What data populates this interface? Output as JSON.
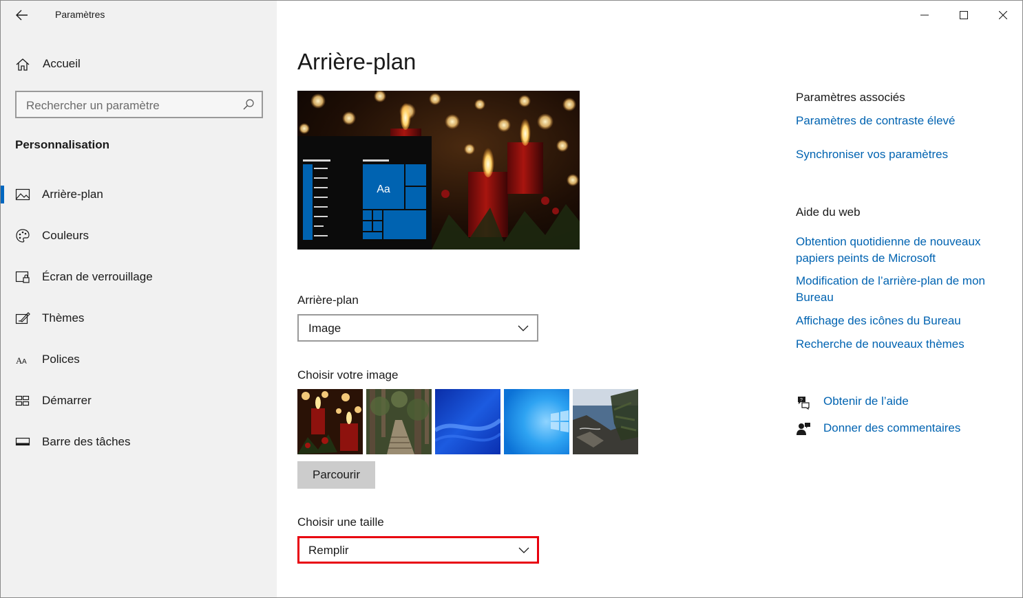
{
  "window": {
    "app_title": "Paramètres",
    "back_icon": "back-arrow-icon",
    "controls": [
      "minimize-icon",
      "maximize-icon",
      "close-icon"
    ]
  },
  "sidebar": {
    "home_label": "Accueil",
    "search_placeholder": "Rechercher un paramètre",
    "section_title": "Personnalisation",
    "items": [
      {
        "label": "Arrière-plan",
        "icon": "picture-icon",
        "active": true
      },
      {
        "label": "Couleurs",
        "icon": "palette-icon",
        "active": false
      },
      {
        "label": "Écran de verrouillage",
        "icon": "lock-screen-icon",
        "active": false
      },
      {
        "label": "Thèmes",
        "icon": "themes-icon",
        "active": false
      },
      {
        "label": "Polices",
        "icon": "fonts-icon",
        "active": false
      },
      {
        "label": "Démarrer",
        "icon": "start-icon",
        "active": false
      },
      {
        "label": "Barre des tâches",
        "icon": "taskbar-icon",
        "active": false
      }
    ]
  },
  "main": {
    "title": "Arrière-plan",
    "preview_tile_text": "Aa",
    "background_label": "Arrière-plan",
    "background_value": "Image",
    "choose_image_label": "Choisir votre image",
    "thumbnails": [
      "candles",
      "forest-path",
      "blue-abstract",
      "windows-blue",
      "rocky-coast"
    ],
    "browse_label": "Parcourir",
    "size_label": "Choisir une taille",
    "size_value": "Remplir"
  },
  "right": {
    "related_title": "Paramètres associés",
    "related_links": [
      "Paramètres de contraste élevé",
      "Synchroniser vos paramètres"
    ],
    "web_help_title": "Aide du web",
    "web_links": [
      "Obtention quotidienne de nouveaux papiers peints de Microsoft",
      "Modification de l’arrière-plan de mon Bureau",
      "Affichage des icônes du Bureau",
      "Recherche de nouveaux thèmes"
    ],
    "get_help": "Obtenir de l’aide",
    "feedback": "Donner des commentaires"
  },
  "colors": {
    "accent": "#0067c0",
    "link": "#0063b1",
    "highlight_border": "#e8000e",
    "sidebar_bg": "#f1f1f1"
  }
}
